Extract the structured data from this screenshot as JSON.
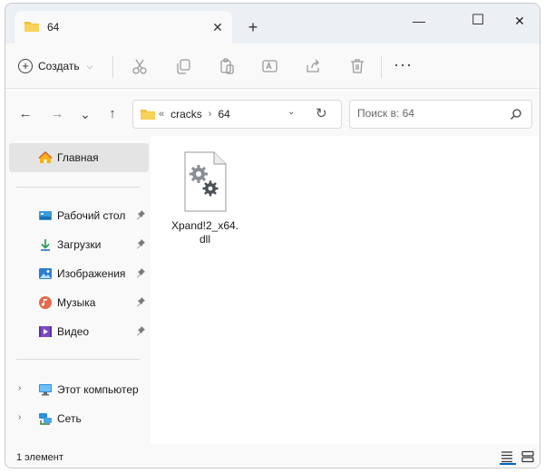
{
  "window": {
    "tab_title": "64",
    "tab_close": "✕",
    "new_tab": "+",
    "minimize": "—",
    "maximize": "☐",
    "close": "✕"
  },
  "toolbar": {
    "create_label": "Создать",
    "more": "···",
    "icons": [
      "cut-icon",
      "copy-icon",
      "paste-icon",
      "rename-icon",
      "share-icon",
      "delete-icon"
    ]
  },
  "nav": {
    "back": "←",
    "forward": "→",
    "recent": "⌄",
    "up": "↑",
    "breadcrumb": [
      "cracks",
      "64"
    ],
    "overflow": "«",
    "separator": "›",
    "refresh": "↻",
    "dropdown": "⌄"
  },
  "search": {
    "placeholder": "Поиск в: 64"
  },
  "sidebar": {
    "home": "Главная",
    "quick": [
      {
        "label": "Рабочий стол",
        "icon": "desktop-icon"
      },
      {
        "label": "Загрузки",
        "icon": "downloads-icon"
      },
      {
        "label": "Изображения",
        "icon": "pictures-icon"
      },
      {
        "label": "Музыка",
        "icon": "music-icon"
      },
      {
        "label": "Видео",
        "icon": "video-icon"
      }
    ],
    "tree": [
      {
        "label": "Этот компьютер",
        "icon": "computer-icon"
      },
      {
        "label": "Сеть",
        "icon": "network-icon"
      }
    ],
    "expand": "›"
  },
  "files": [
    {
      "name": "Xpand!2_x64.dll",
      "icon": "dll-file-icon"
    }
  ],
  "status": {
    "count": "1 элемент"
  },
  "colors": {
    "accent": "#0067c0",
    "folder": "#f3c33f",
    "selected": "#e4e4e4"
  }
}
